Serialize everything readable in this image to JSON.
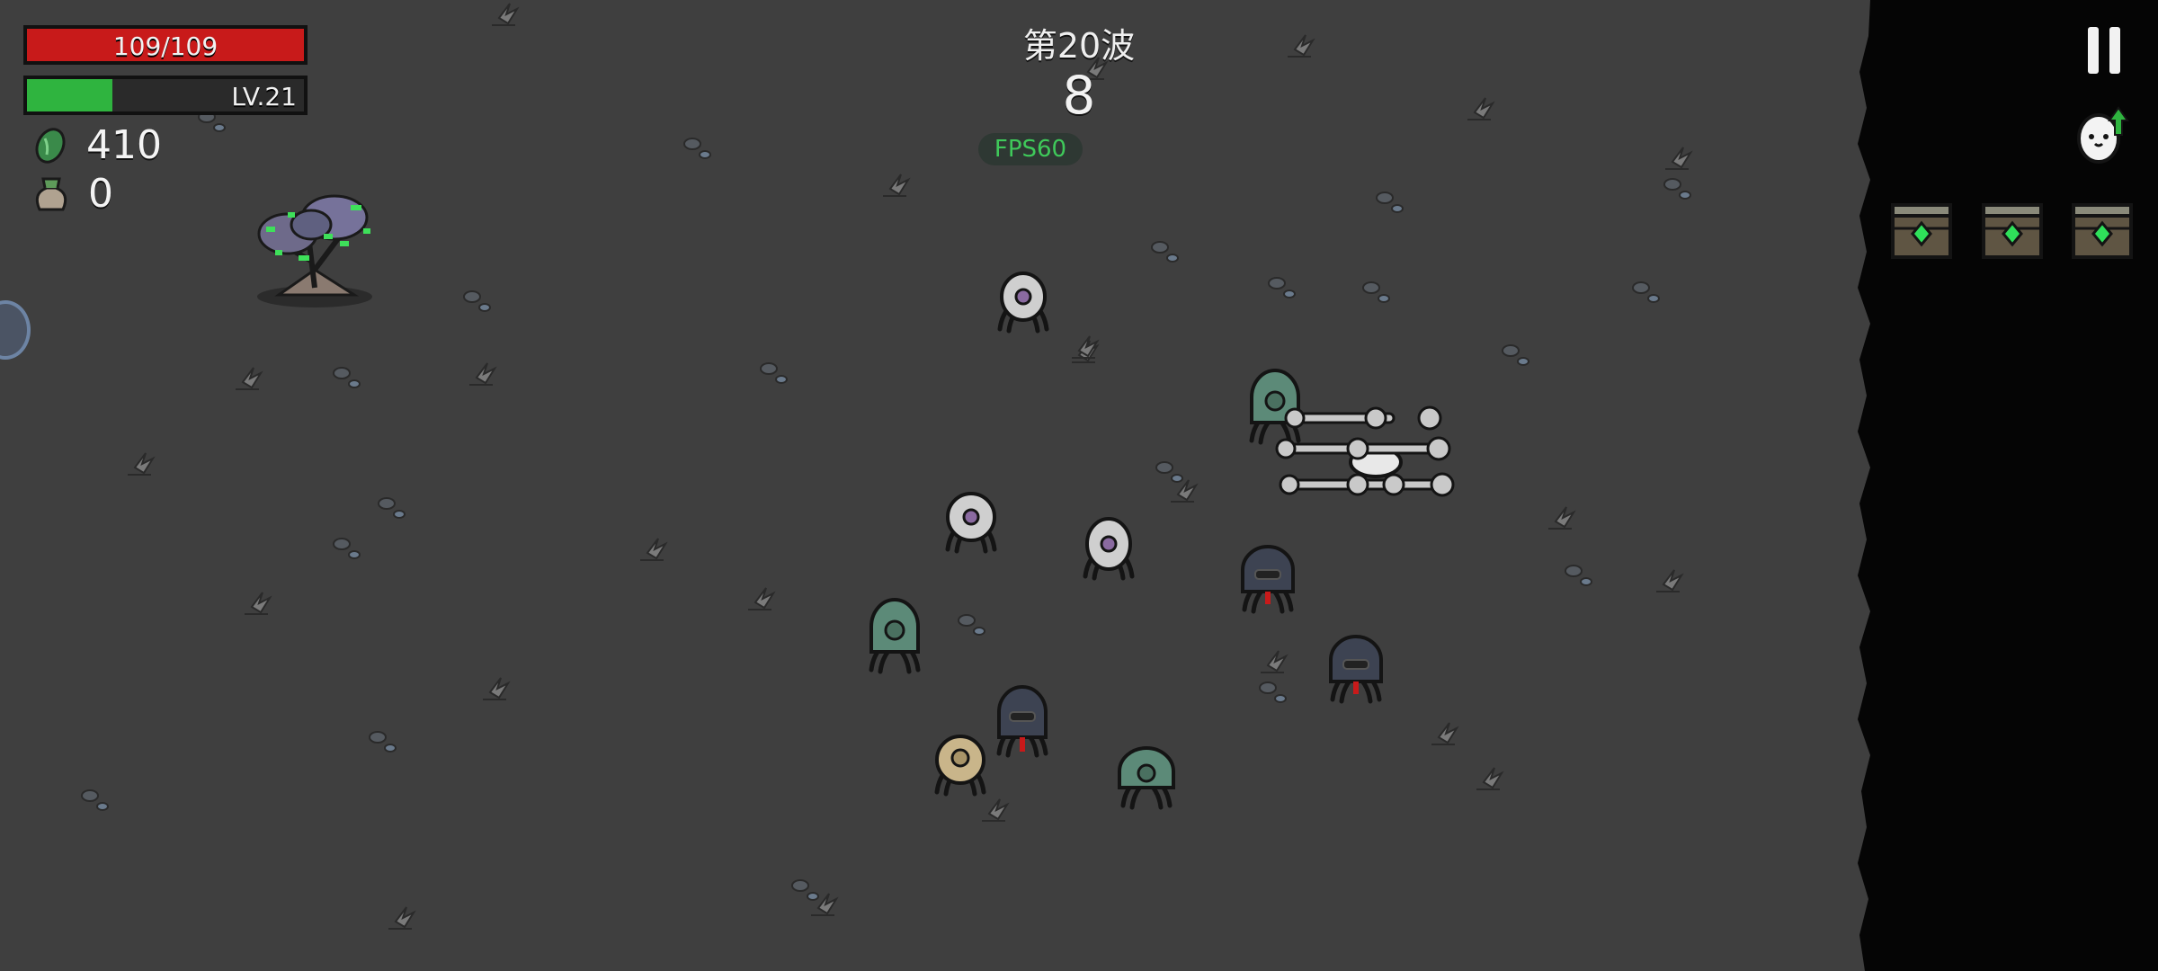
{
  "hud": {
    "hp": {
      "text": "109/109",
      "current": 109,
      "max": 109,
      "color": "#c81a1a"
    },
    "xp": {
      "level_text": "LV.21",
      "fill_fraction": 0.31,
      "color": "#2fb43f"
    },
    "materials": {
      "icon": "green-material-icon",
      "value": "410"
    },
    "bag": {
      "icon": "money-bag-icon",
      "value": "0"
    },
    "wave": {
      "title": "第20波",
      "timer": "8"
    },
    "fps": "FPS60",
    "pause_icon": "pause-icon",
    "levelup_icon": "egg-levelup-icon",
    "crates": [
      "loot-crate-icon",
      "loot-crate-icon",
      "loot-crate-icon"
    ]
  },
  "colors": {
    "ground": "#3f3f3f",
    "void": "#050505",
    "enemy_green": "#5c8a78",
    "enemy_dark": "#3d4352",
    "enemy_white": "#cfcfcf",
    "enemy_tan": "#c9b58a",
    "tree_glow": "#3ee05a"
  }
}
